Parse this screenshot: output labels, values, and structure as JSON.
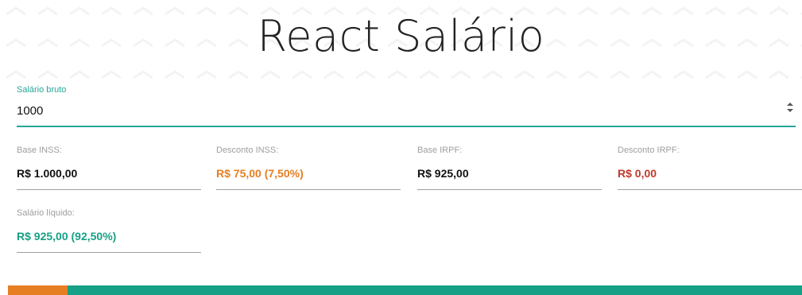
{
  "title": "React Salário",
  "salary_input": {
    "label": "Salário bruto",
    "value": "1000"
  },
  "fields": [
    {
      "label": "Base INSS:",
      "value": "R$ 1.000,00"
    },
    {
      "label": "Desconto INSS:",
      "value": "R$ 75,00 (7,50%)"
    },
    {
      "label": "Base IRPF:",
      "value": "R$ 925,00"
    },
    {
      "label": "Desconto IRPF:",
      "value": "R$ 0,00"
    },
    {
      "label": "Salário líquido:",
      "value": "R$ 925,00 (92,50%)"
    }
  ],
  "distribution_bar": {
    "inss_percent": 7.5,
    "irpf_percent": 0,
    "net_percent": 92.5
  },
  "colors": {
    "accent": "#26a69a",
    "inss": "#e67e22",
    "irpf": "#c0392b",
    "net": "#16a085",
    "text_default": "#111111"
  }
}
